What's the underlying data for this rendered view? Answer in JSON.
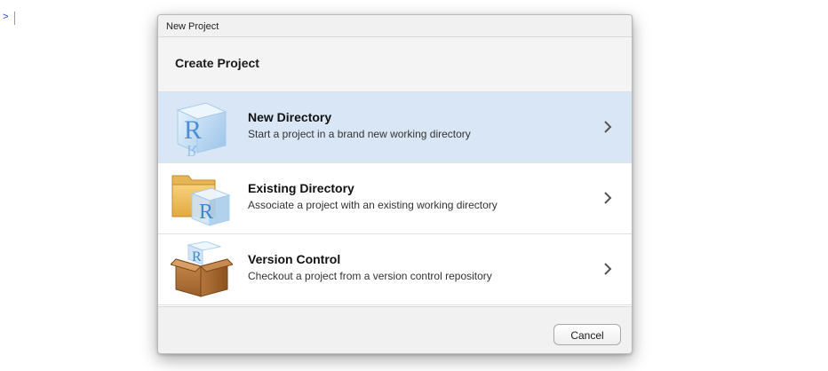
{
  "console": {
    "prompt": ">"
  },
  "dialog": {
    "window_title": "New Project",
    "heading": "Create Project",
    "options": [
      {
        "title": "New Directory",
        "description": "Start a project in a brand new working directory",
        "icon": "r-cube-icon",
        "selected": true
      },
      {
        "title": "Existing Directory",
        "description": "Associate a project with an existing working directory",
        "icon": "folder-r-cube-icon",
        "selected": false
      },
      {
        "title": "Version Control",
        "description": "Checkout a project from a version control repository",
        "icon": "box-r-cube-icon",
        "selected": false
      }
    ],
    "cancel_label": "Cancel"
  },
  "colors": {
    "selected_row": "#d9e6f5",
    "prompt": "#1a3fd1",
    "r_blue": "#4b8fd6"
  }
}
